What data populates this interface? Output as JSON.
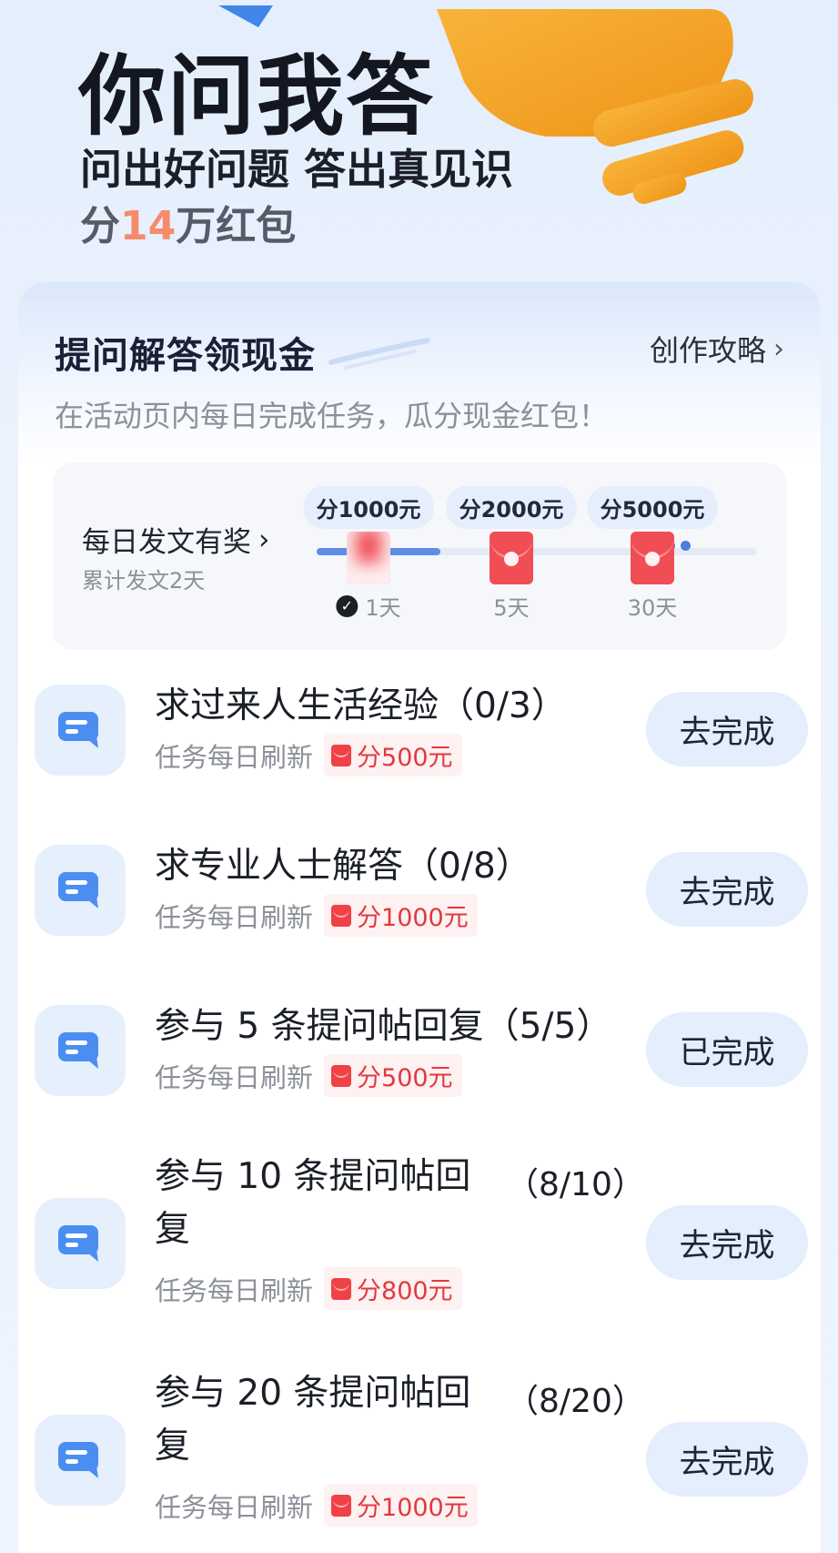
{
  "hero": {
    "title": "你问我答",
    "subtitle": "问出好问题 答出真见识",
    "prize_prefix": "分",
    "prize_number": "14",
    "prize_suffix": "万红包"
  },
  "card": {
    "title": "提问解答领现金",
    "guide_link": "创作攻略",
    "description": "在活动页内每日完成任务，瓜分现金红包！"
  },
  "daily_post": {
    "title": "每日发文有奖",
    "subtitle": "累计发文2天",
    "progress_fraction": 0.28,
    "milestones": [
      {
        "reward": "分1000元",
        "day": "1天",
        "completed": true
      },
      {
        "reward": "分2000元",
        "day": "5天",
        "completed": false
      },
      {
        "reward": "分5000元",
        "day": "30天",
        "completed": false
      }
    ]
  },
  "tasks": [
    {
      "name": "求过来人生活经验（0/3）",
      "progress": "",
      "refresh": "任务每日刷新",
      "reward": "分500元",
      "button": "去完成"
    },
    {
      "name": "求专业人士解答（0/8）",
      "progress": "",
      "refresh": "任务每日刷新",
      "reward": "分1000元",
      "button": "去完成"
    },
    {
      "name": "参与 5 条提问帖回复（5/5）",
      "progress": "",
      "refresh": "任务每日刷新",
      "reward": "分500元",
      "button": "已完成"
    },
    {
      "name": "参与 10 条提问帖回复",
      "progress": "（8/10）",
      "refresh": "任务每日刷新",
      "reward": "分800元",
      "button": "去完成"
    },
    {
      "name": "参与 20 条提问帖回复",
      "progress": "（8/20）",
      "refresh": "任务每日刷新",
      "reward": "分1000元",
      "button": "去完成"
    }
  ],
  "colors": {
    "accent_blue": "#5d8ee4",
    "red_packet": "#f14d54",
    "prize_number": "#f78a6b",
    "bulb_orange": "#f4a62a"
  }
}
